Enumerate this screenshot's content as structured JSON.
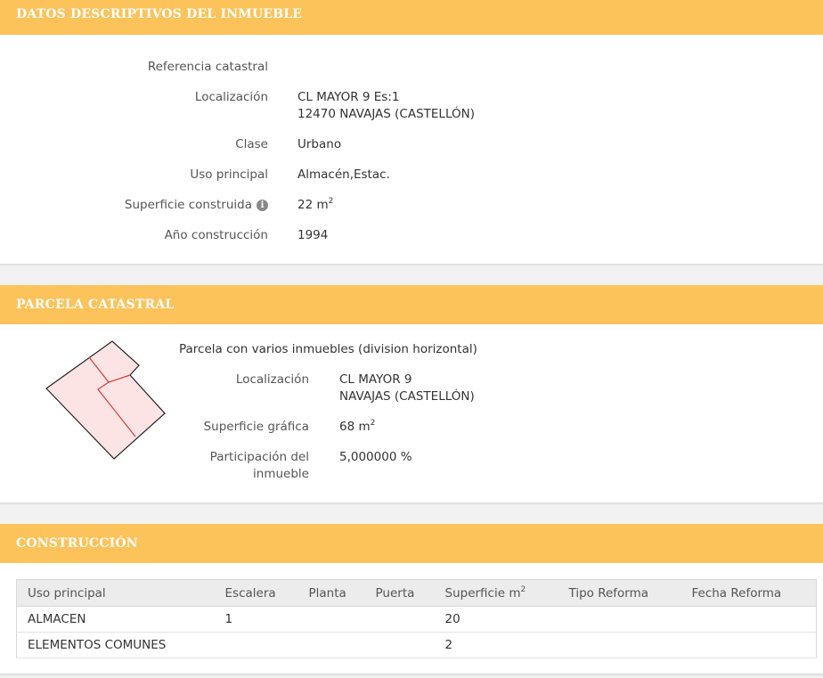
{
  "descriptive": {
    "header": "DATOS DESCRIPTIVOS DEL INMUEBLE",
    "fields": {
      "referencia_label": "Referencia catastral",
      "referencia_value": "",
      "localizacion_label": "Localización",
      "localizacion_line1": "CL MAYOR 9 Es:1",
      "localizacion_line2": "12470 NAVAJAS (CASTELLÓN)",
      "clase_label": "Clase",
      "clase_value": "Urbano",
      "uso_label": "Uso principal",
      "uso_value": "Almacén,Estac.",
      "superficie_label": "Superficie construida",
      "superficie_value": "22 m",
      "superficie_unit_sup": "2",
      "anio_label": "Año construcción",
      "anio_value": "1994",
      "info_icon_glyph": "i"
    }
  },
  "parcela": {
    "header": "PARCELA CATASTRAL",
    "title": "Parcela con varios inmuebles (division horizontal)",
    "localizacion_label": "Localización",
    "localizacion_line1": "CL MAYOR 9",
    "localizacion_line2": "NAVAJAS (CASTELLÓN)",
    "superficie_label": "Superficie gráfica",
    "superficie_value": "68 m",
    "superficie_unit_sup": "2",
    "participacion_label_line1": "Participación del",
    "participacion_label_line2": "inmueble",
    "participacion_value": "5,000000 %",
    "colors": {
      "fill": "#fde4e4",
      "outline": "#222222",
      "inner": "#d33a3a"
    }
  },
  "construccion": {
    "header": "CONSTRUCCIÓN",
    "columns": [
      "Uso principal",
      "Escalera",
      "Planta",
      "Puerta",
      "Superficie m",
      "Tipo Reforma",
      "Fecha Reforma"
    ],
    "superficie_col_sup": "2",
    "rows": [
      [
        "ALMACEN",
        "1",
        "",
        "",
        "20",
        "",
        ""
      ],
      [
        "ELEMENTOS COMUNES",
        "",
        "",
        "",
        "2",
        "",
        ""
      ]
    ]
  },
  "colors": {
    "header_bg": "#fcc35a",
    "header_text": "#ffffff"
  }
}
